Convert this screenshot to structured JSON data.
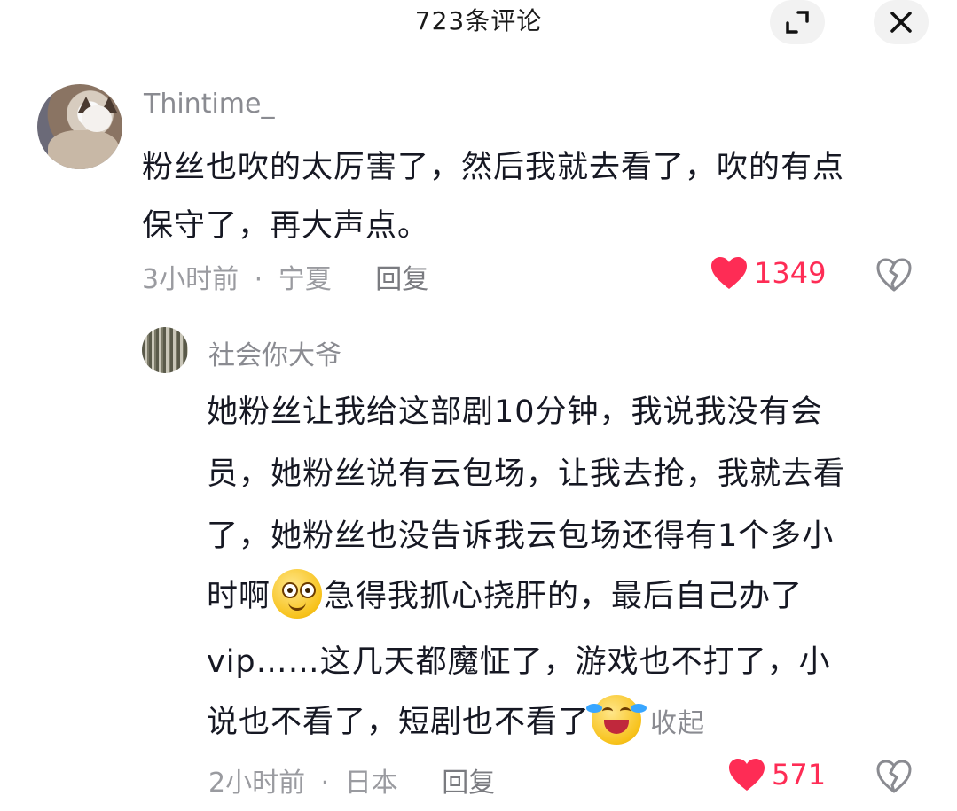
{
  "header": {
    "title": "723条评论",
    "expand_icon": "expand-icon",
    "close_icon": "close-icon"
  },
  "comment": {
    "username": "Thintime_",
    "lines": [
      "粉丝也吹的太厉害了，然后我就去看了，吹的有点",
      "保守了，再大声点。"
    ],
    "time": "3小时前",
    "separator": "·",
    "location": "宁夏",
    "reply_label": "回复",
    "likes": "1349",
    "like_color": "#fe2c55"
  },
  "reply": {
    "username": "社会你大爷",
    "lines": [
      "她粉丝让我给这部剧10分钟，我说我没有会",
      "员，她粉丝说有云包场，让我去抢，我就去看",
      "了，她粉丝也没告诉我云包场还得有1个多小",
      "时啊",
      "急得我抓心挠肝的，最后自己办了",
      "vip……这几天都魔怔了，游戏也不打了，小",
      "说也不看了，短剧也不看了"
    ],
    "collapse_label": "收起",
    "time": "2小时前",
    "separator": "·",
    "location": "日本",
    "reply_label": "回复",
    "likes": "571"
  }
}
